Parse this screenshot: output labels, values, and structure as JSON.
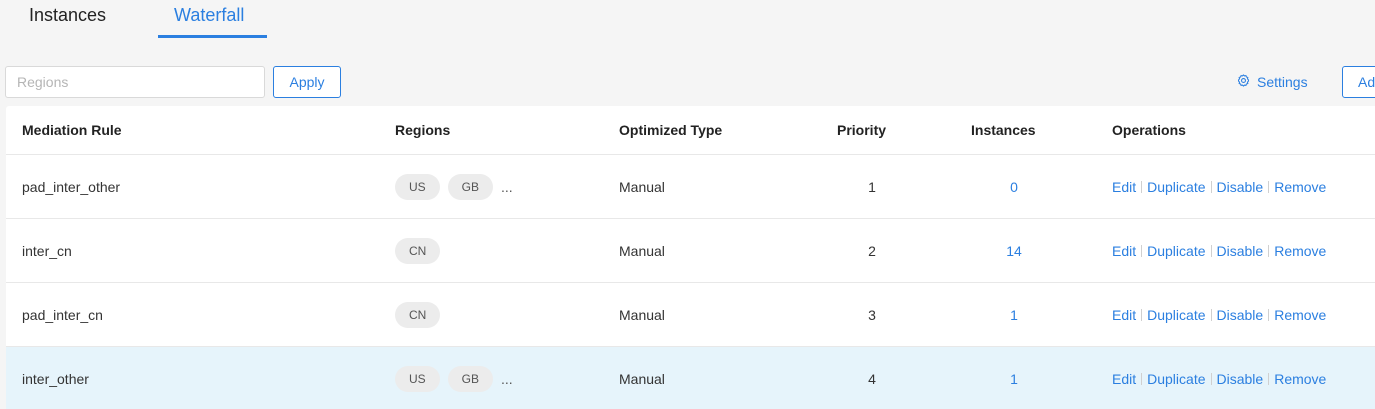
{
  "tabs": [
    {
      "label": "Instances",
      "active": false
    },
    {
      "label": "Waterfall",
      "active": true
    }
  ],
  "toolbar": {
    "regions_placeholder": "Regions",
    "regions_value": "",
    "apply_label": "Apply",
    "settings_label": "Settings",
    "add_label": "Add"
  },
  "table": {
    "headers": {
      "rule": "Mediation Rule",
      "regions": "Regions",
      "type": "Optimized Type",
      "priority": "Priority",
      "instances": "Instances",
      "operations": "Operations"
    },
    "rows": [
      {
        "rule": "pad_inter_other",
        "regions": [
          "US",
          "GB"
        ],
        "more": "...",
        "type": "Manual",
        "priority": "1",
        "instances": "0"
      },
      {
        "rule": "inter_cn",
        "regions": [
          "CN"
        ],
        "more": "",
        "type": "Manual",
        "priority": "2",
        "instances": "14"
      },
      {
        "rule": "pad_inter_cn",
        "regions": [
          "CN"
        ],
        "more": "",
        "type": "Manual",
        "priority": "3",
        "instances": "1"
      },
      {
        "rule": "inter_other",
        "regions": [
          "US",
          "GB"
        ],
        "more": "...",
        "type": "Manual",
        "priority": "4",
        "instances": "1"
      }
    ],
    "operations": {
      "edit": "Edit",
      "duplicate": "Duplicate",
      "disable": "Disable",
      "remove": "Remove"
    }
  },
  "colors": {
    "accent": "#2b7fe0",
    "highlight_row": "#e6f4fb",
    "tag_bg": "#ececec"
  }
}
